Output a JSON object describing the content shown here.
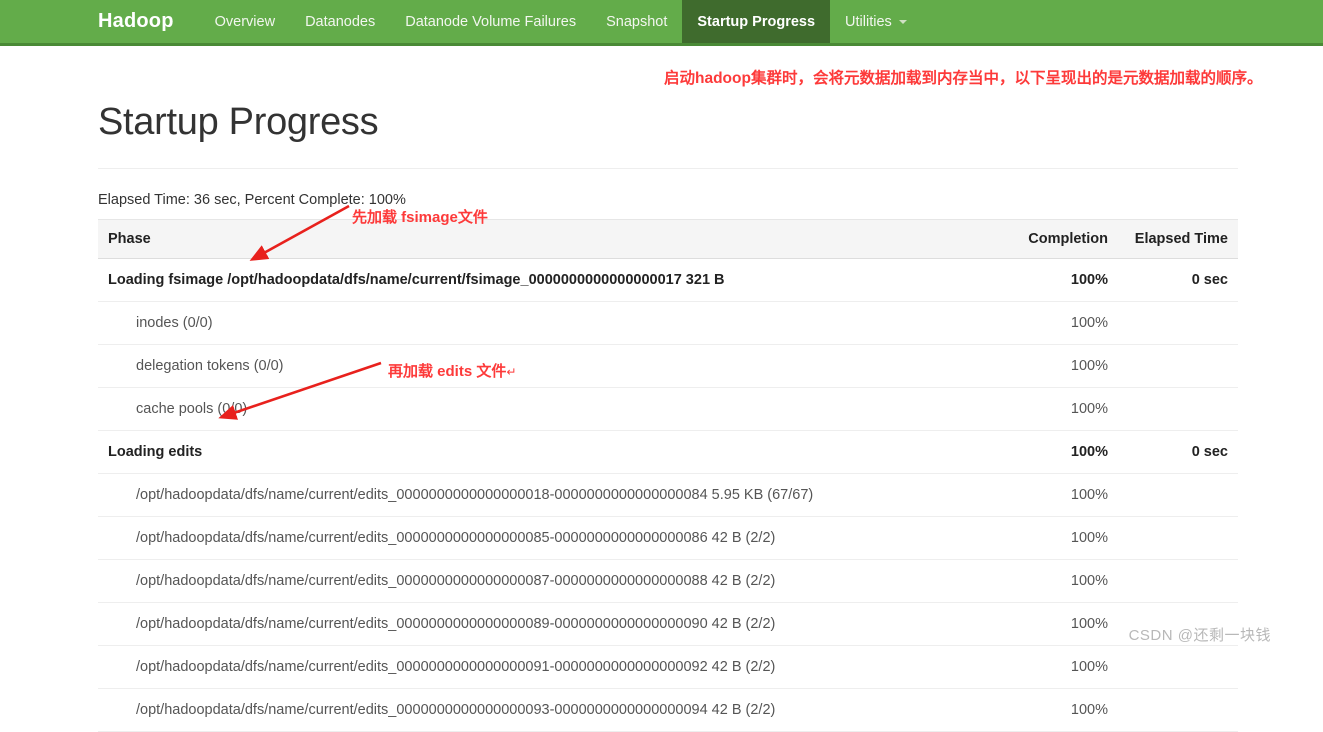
{
  "navbar": {
    "brand": "Hadoop",
    "items": [
      {
        "label": "Overview",
        "active": false,
        "caret": false
      },
      {
        "label": "Datanodes",
        "active": false,
        "caret": false
      },
      {
        "label": "Datanode Volume Failures",
        "active": false,
        "caret": false
      },
      {
        "label": "Snapshot",
        "active": false,
        "caret": false
      },
      {
        "label": "Startup Progress",
        "active": true,
        "caret": false
      },
      {
        "label": "Utilities",
        "active": false,
        "caret": true
      }
    ],
    "colors": {
      "background": "#63ac4a",
      "active_background": "#3f6b2d",
      "border_bottom": "#4a8a36",
      "text": "#f2f6ef"
    }
  },
  "page": {
    "title": "Startup Progress",
    "elapsed_summary": "Elapsed Time: 36 sec, Percent Complete: 100%"
  },
  "table": {
    "headers": {
      "phase": "Phase",
      "completion": "Completion",
      "elapsed_time": "Elapsed Time"
    },
    "rows": [
      {
        "type": "phase",
        "phase": "Loading fsimage /opt/hadoopdata/dfs/name/current/fsimage_0000000000000000017 321 B",
        "completion": "100%",
        "elapsed": "0 sec"
      },
      {
        "type": "step",
        "phase": "inodes (0/0)",
        "completion": "100%",
        "elapsed": ""
      },
      {
        "type": "step",
        "phase": "delegation tokens (0/0)",
        "completion": "100%",
        "elapsed": ""
      },
      {
        "type": "step",
        "phase": "cache pools (0/0)",
        "completion": "100%",
        "elapsed": ""
      },
      {
        "type": "phase",
        "phase": "Loading edits",
        "completion": "100%",
        "elapsed": "0 sec"
      },
      {
        "type": "step",
        "phase": "/opt/hadoopdata/dfs/name/current/edits_0000000000000000018-0000000000000000084 5.95 KB (67/67)",
        "completion": "100%",
        "elapsed": ""
      },
      {
        "type": "step",
        "phase": "/opt/hadoopdata/dfs/name/current/edits_0000000000000000085-0000000000000000086 42 B (2/2)",
        "completion": "100%",
        "elapsed": ""
      },
      {
        "type": "step",
        "phase": "/opt/hadoopdata/dfs/name/current/edits_0000000000000000087-0000000000000000088 42 B (2/2)",
        "completion": "100%",
        "elapsed": ""
      },
      {
        "type": "step",
        "phase": "/opt/hadoopdata/dfs/name/current/edits_0000000000000000089-0000000000000000090 42 B (2/2)",
        "completion": "100%",
        "elapsed": ""
      },
      {
        "type": "step",
        "phase": "/opt/hadoopdata/dfs/name/current/edits_0000000000000000091-0000000000000000092 42 B (2/2)",
        "completion": "100%",
        "elapsed": ""
      },
      {
        "type": "step",
        "phase": "/opt/hadoopdata/dfs/name/current/edits_0000000000000000093-0000000000000000094 42 B (2/2)",
        "completion": "100%",
        "elapsed": ""
      }
    ]
  },
  "annotations": {
    "color": "#fd3a3a",
    "top_note": "启动hadoop集群时，会将元数据加载到内存当中，以下呈现出的是元数据加载的顺序。",
    "fsimage_note": "先加载 fsimage文件",
    "edits_note": "再加载 edits 文件",
    "edits_note_tail": "↵"
  },
  "watermark": "CSDN @还剩一块钱"
}
